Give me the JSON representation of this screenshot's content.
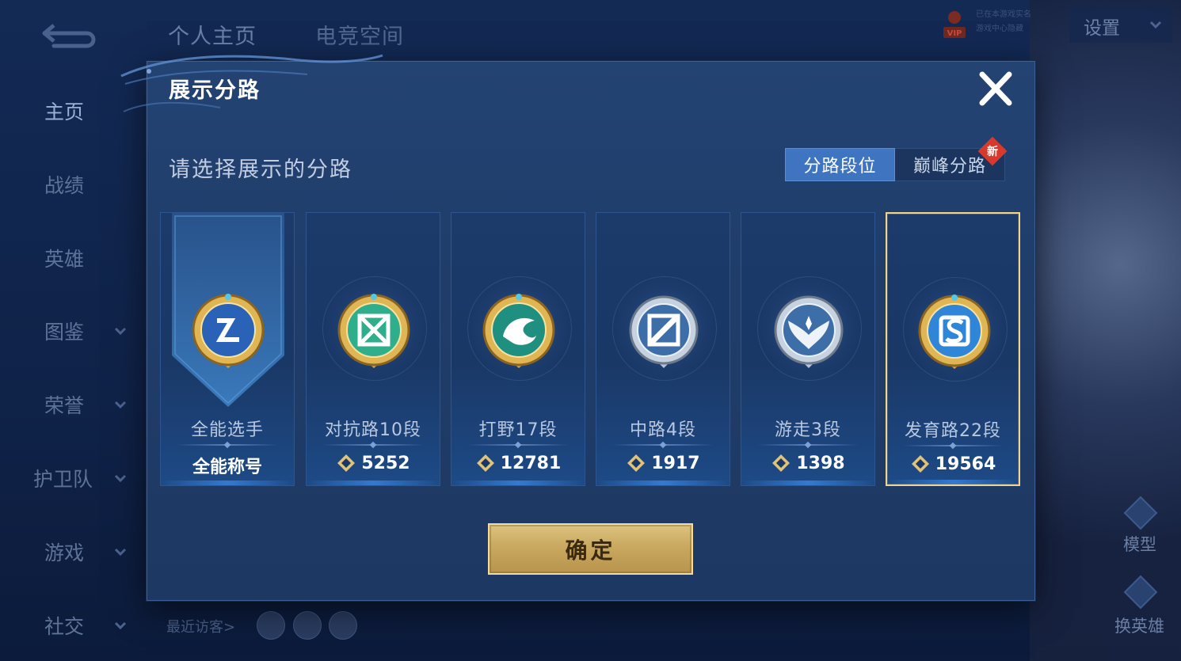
{
  "header": {
    "tabs": [
      {
        "label": "个人主页"
      },
      {
        "label": "电竞空间"
      }
    ],
    "realname_line1": "已在本游戏实名",
    "realname_line2": "游戏中心隐藏",
    "settings_label": "设置"
  },
  "sidebar": {
    "items": [
      {
        "label": "主页",
        "has_chevron": false
      },
      {
        "label": "战绩",
        "has_chevron": false
      },
      {
        "label": "英雄",
        "has_chevron": false
      },
      {
        "label": "图鉴",
        "has_chevron": true
      },
      {
        "label": "荣誉",
        "has_chevron": true
      },
      {
        "label": "护卫队",
        "has_chevron": true
      },
      {
        "label": "游戏",
        "has_chevron": true
      },
      {
        "label": "社交",
        "has_chevron": true
      }
    ]
  },
  "footer": {
    "visitors_label": "最近访客>",
    "model_label": "模型",
    "switch_hero_label": "换英雄"
  },
  "modal": {
    "title": "展示分路",
    "prompt": "请选择展示的分路",
    "segment": {
      "active": "分路段位",
      "inactive": "巅峰分路",
      "badge": "新"
    },
    "cards": [
      {
        "name": "全能选手",
        "value": "全能称号",
        "icon": "all-round-emblem-icon",
        "selected": false
      },
      {
        "name": "对抗路10段",
        "value": "5252",
        "icon": "clash-lane-emblem-icon",
        "selected": false
      },
      {
        "name": "打野17段",
        "value": "12781",
        "icon": "jungle-dragon-emblem-icon",
        "selected": false
      },
      {
        "name": "中路4段",
        "value": "1917",
        "icon": "mid-lane-emblem-icon",
        "selected": false
      },
      {
        "name": "游走3段",
        "value": "1398",
        "icon": "roam-wings-emblem-icon",
        "selected": false
      },
      {
        "name": "发育路22段",
        "value": "19564",
        "icon": "farm-lane-emblem-icon",
        "selected": true
      }
    ],
    "confirm_label": "确定"
  },
  "colors": {
    "accent_blue": "#3f74c0",
    "gold": "#c9a860",
    "selected_border": "#f2d48b",
    "new_badge": "#d73a2c"
  }
}
